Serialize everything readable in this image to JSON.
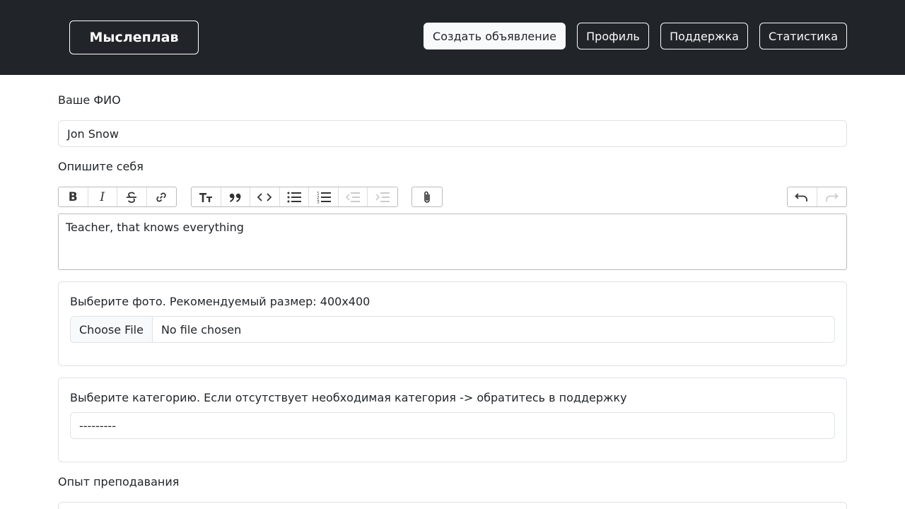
{
  "navbar": {
    "brand": "Мыслеплав",
    "buttons": [
      "Создать объявление",
      "Профиль",
      "Поддержка",
      "Статистика"
    ]
  },
  "form": {
    "name_label": "Ваше ФИО",
    "name_value": "Jon Snow",
    "about_label": "Опишите себя",
    "about_value": "Teacher, that knows everything",
    "photo_label": "Выберите фото. Рекомендуемый размер: 400x400",
    "file_button": "Choose File",
    "file_status": "No file chosen",
    "category_label": "Выберите категорию. Если отсутствует необходимая категория -> обратитесь в поддержку",
    "category_value": "---------",
    "experience_label": "Опыт преподавания"
  },
  "toolbar": {
    "icons": [
      "bold-icon",
      "italic-icon",
      "strike-icon",
      "link-icon",
      "heading-icon",
      "quote-icon",
      "code-icon",
      "bullet-list-icon",
      "number-list-icon",
      "outdent-icon",
      "indent-icon",
      "attach-icon",
      "undo-icon",
      "redo-icon"
    ]
  },
  "colors": {
    "navbar_bg": "#212529",
    "text": "#212529",
    "border": "#dee2e6"
  }
}
